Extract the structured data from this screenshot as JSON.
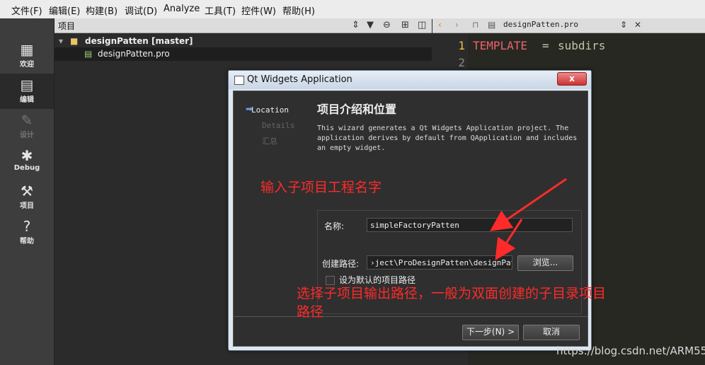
{
  "menu": [
    "文件(F)",
    "编辑(E)",
    "构建(B)",
    "调试(D)",
    "Analyze",
    "工具(T)",
    "控件(W)",
    "帮助(H)"
  ],
  "modes": [
    {
      "label": "欢迎",
      "icon": "grid-icon"
    },
    {
      "label": "编辑",
      "icon": "edit-document-icon"
    },
    {
      "label": "设计",
      "icon": "pencil-icon"
    },
    {
      "label": "Debug",
      "icon": "bug-icon"
    },
    {
      "label": "项目",
      "icon": "wrench-icon"
    },
    {
      "label": "帮助",
      "icon": "help-icon"
    }
  ],
  "project_panel": {
    "title": "项目",
    "root": "designPatten [master]",
    "child": "designPatten.pro"
  },
  "editor": {
    "tab": "designPatten.pro",
    "line1_num": "1",
    "line2_num": "2",
    "code_keyword": "TEMPLATE",
    "code_op": "=",
    "code_value": "subdirs"
  },
  "dialog": {
    "title": "Qt Widgets Application",
    "close_label": "x",
    "steps": [
      "Location",
      "Details",
      "汇总"
    ],
    "heading": "项目介绍和位置",
    "description": "This wizard generates a Qt Widgets Application project. The application derives by default from QApplication and includes an empty widget.",
    "name_label": "名称:",
    "name_value": "simpleFactoryPatten",
    "path_label": "创建路径:",
    "path_value": "›ject\\ProDesignPatten\\designPatten",
    "browse_label": "浏览...",
    "default_path_label": "设为默认的项目路径",
    "next_label": "下一步(N) >",
    "cancel_label": "取消"
  },
  "annotations": {
    "top": "输入子项目工程名字",
    "bottom_line1": "选择子项目输出路径，一般为双面创建的子目录项目",
    "bottom_line2": "路径"
  },
  "watermark": "https://blog.csdn.net/ARM55",
  "colors": {
    "annotation": "#ff2a2a",
    "keyword": "#f92672",
    "code_text": "#c3c3a8"
  }
}
